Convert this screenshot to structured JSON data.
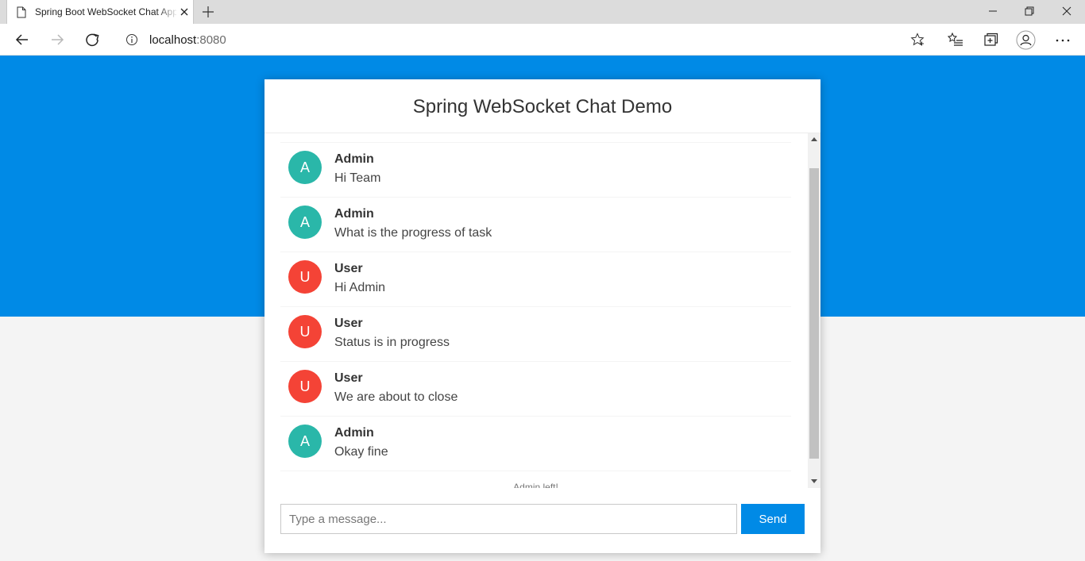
{
  "browser": {
    "tab_title": "Spring Boot WebSocket Chat Application",
    "url_host": "localhost",
    "url_port": ":8080"
  },
  "page": {
    "title": "Spring WebSocket Chat Demo",
    "messages": [
      {
        "sender": "Admin",
        "initial": "A",
        "text": "Hi Team",
        "color": "#2ab7a9"
      },
      {
        "sender": "Admin",
        "initial": "A",
        "text": "What is the progress of task",
        "color": "#2ab7a9"
      },
      {
        "sender": "User",
        "initial": "U",
        "text": "Hi Admin",
        "color": "#f44336"
      },
      {
        "sender": "User",
        "initial": "U",
        "text": "Status is in progress",
        "color": "#f44336"
      },
      {
        "sender": "User",
        "initial": "U",
        "text": "We are about to close",
        "color": "#f44336"
      },
      {
        "sender": "Admin",
        "initial": "A",
        "text": "Okay fine",
        "color": "#2ab7a9"
      }
    ],
    "event_message": "Admin left!",
    "input_placeholder": "Type a message...",
    "send_label": "Send"
  },
  "colors": {
    "banner": "#008ae6",
    "send_button": "#008ae6",
    "admin_avatar": "#2ab7a9",
    "user_avatar": "#f44336"
  }
}
